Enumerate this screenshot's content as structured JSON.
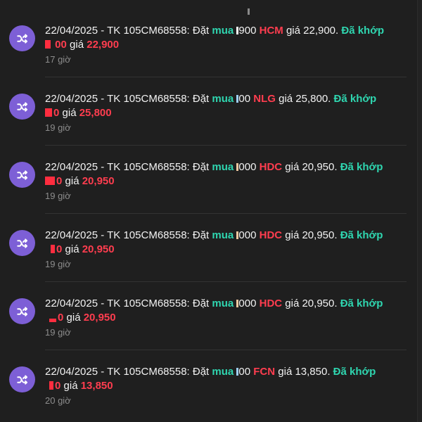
{
  "feed": {
    "items": [
      {
        "prefix": "22/04/2025 - TK 105CM68558: Đặt",
        "action": "mua",
        "qty": "900",
        "symbol": "HCM",
        "price_text": "giá 22,900.",
        "status": "Đã khớp",
        "matched_qty": "00",
        "matched_price_label": "giá",
        "matched_price": "22,900",
        "time": "17 giờ",
        "chip_color": "#ffffff"
      },
      {
        "prefix": "22/04/2025 - TK 105CM68558: Đặt",
        "action": "mua",
        "qty": "00",
        "symbol": "NLG",
        "price_text": "giá 25,800.",
        "status": "Đã khớp",
        "matched_qty": "0",
        "matched_price_label": "giá",
        "matched_price": "25,800",
        "time": "19 giờ",
        "chip_color": "#9fd0ff"
      },
      {
        "prefix": "22/04/2025 - TK 105CM68558: Đặt",
        "action": "mua",
        "qty": "000",
        "symbol": "HDC",
        "price_text": "giá 20,950.",
        "status": "Đã khớp",
        "matched_qty": "0",
        "matched_price_label": "giá",
        "matched_price": "20,950",
        "time": "19 giờ",
        "chip_color": "#f2c9a0"
      },
      {
        "prefix": "22/04/2025 - TK 105CM68558: Đặt",
        "action": "mua",
        "qty": "000",
        "symbol": "HDC",
        "price_text": "giá 20,950.",
        "status": "Đã khớp",
        "matched_qty": "0",
        "matched_price_label": "giá",
        "matched_price": "20,950",
        "time": "19 giờ",
        "chip_color": "#f2c9a0"
      },
      {
        "prefix": "22/04/2025 - TK 105CM68558: Đặt",
        "action": "mua",
        "qty": "000",
        "symbol": "HDC",
        "price_text": "giá 20,950.",
        "status": "Đã khớp",
        "matched_qty": "0",
        "matched_price_label": "giá",
        "matched_price": "20,950",
        "time": "19 giờ",
        "chip_color": "#f2c9a0"
      },
      {
        "prefix": "22/04/2025 - TK 105CM68558: Đặt",
        "action": "mua",
        "qty": "00",
        "symbol": "FCN",
        "price_text": "giá 13,850.",
        "status": "Đã khớp",
        "matched_qty": "0",
        "matched_price_label": "giá",
        "matched_price": "13,850",
        "time": "20 giờ",
        "chip_color": "#9fd0ff"
      }
    ]
  },
  "colors": {
    "background": "#1f1f1f",
    "avatar": "#7d5fd6",
    "buy_green": "#2fd6b0",
    "symbol_red": "#ff3d4f",
    "muted": "#8d8d8d"
  },
  "icons": {
    "avatar_icon": "shuffle-icon"
  }
}
